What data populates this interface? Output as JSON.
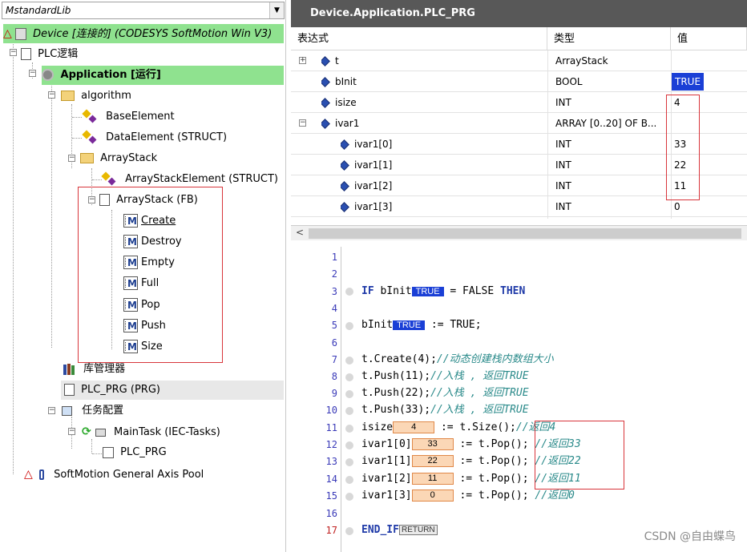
{
  "combo": {
    "value": "MstandardLib"
  },
  "tree": {
    "device": "Device [连接的] (CODESYS SoftMotion Win V3)",
    "plc_logic": "PLC逻辑",
    "application": "Application [运行]",
    "algorithm": "algorithm",
    "base_element": "BaseElement",
    "data_element": "DataElement (STRUCT)",
    "array_stack_folder": "ArrayStack",
    "array_stack_element": "ArrayStackElement (STRUCT)",
    "array_stack_fb": "ArrayStack (FB)",
    "methods": [
      "Create",
      "Destroy",
      "Empty",
      "Full",
      "Pop",
      "Push",
      "Size"
    ],
    "lib_manager": "库管理器",
    "plc_prg": "PLC_PRG (PRG)",
    "task_config": "任务配置",
    "main_task": "MainTask (IEC-Tasks)",
    "task_prg": "PLC_PRG",
    "axis_pool": "SoftMotion General Axis Pool"
  },
  "editor_title": "Device.Application.PLC_PRG",
  "watch": {
    "headers": [
      "表达式",
      "类型",
      "值"
    ],
    "rows": [
      {
        "expr": "t",
        "type": "ArrayStack",
        "value": ""
      },
      {
        "expr": "bInit",
        "type": "BOOL",
        "value": "TRUE"
      },
      {
        "expr": "isize",
        "type": "INT",
        "value": "4"
      },
      {
        "expr": "ivar1",
        "type": "ARRAY [0..20] OF B...",
        "value": ""
      },
      {
        "expr": "ivar1[0]",
        "type": "INT",
        "value": "33"
      },
      {
        "expr": "ivar1[1]",
        "type": "INT",
        "value": "22"
      },
      {
        "expr": "ivar1[2]",
        "type": "INT",
        "value": "11"
      },
      {
        "expr": "ivar1[3]",
        "type": "INT",
        "value": "0"
      }
    ]
  },
  "code": {
    "line_numbers": [
      "1",
      "2",
      "3",
      "4",
      "5",
      "6",
      "7",
      "8",
      "9",
      "10",
      "11",
      "12",
      "13",
      "14",
      "15",
      "16",
      "17"
    ],
    "l3_a": "IF ",
    "l3_b": "bInit",
    "l3_v": "TRUE",
    "l3_c": " = FALSE ",
    "l3_d": "THEN",
    "l5_a": "bInit",
    "l5_v": "TRUE",
    "l5_b": " := TRUE;",
    "l7_a": "t.Create(4);",
    "l7_c": "//动态创建栈内数组大小",
    "l8_a": "t.Push(11);",
    "l8_c": "//入栈 , 返回TRUE",
    "l9_a": "t.Push(22);",
    "l9_c": "//入栈 , 返回TRUE",
    "l10_a": "t.Push(33);",
    "l10_c": "//入栈 , 返回TRUE",
    "l11_a": "isize",
    "l11_v": "4",
    "l11_b": " := t.Size();",
    "l11_c": "//返回4",
    "l12_a": "ivar1[0]",
    "l12_v": "33",
    "l12_b": " := t.Pop(); ",
    "l12_c": "//返回33",
    "l13_a": "ivar1[1]",
    "l13_v": "22",
    "l13_b": " := t.Pop(); ",
    "l13_c": "//返回22",
    "l14_a": "ivar1[2]",
    "l14_v": "11",
    "l14_b": " := t.Pop(); ",
    "l14_c": "//返回11",
    "l15_a": "ivar1[3]",
    "l15_v": "0",
    "l15_b": " := t.Pop(); ",
    "l15_c": "//返回0",
    "l17_a": "END_IF",
    "l17_r": "RETURN"
  },
  "watermark": "CSDN @自由蝶鸟",
  "colors": {
    "accent_blue": "#1a3fd6",
    "online_value_bg": "#fbd7b6",
    "highlight_green": "#8fe28f",
    "annotation_red": "#d8353b"
  }
}
